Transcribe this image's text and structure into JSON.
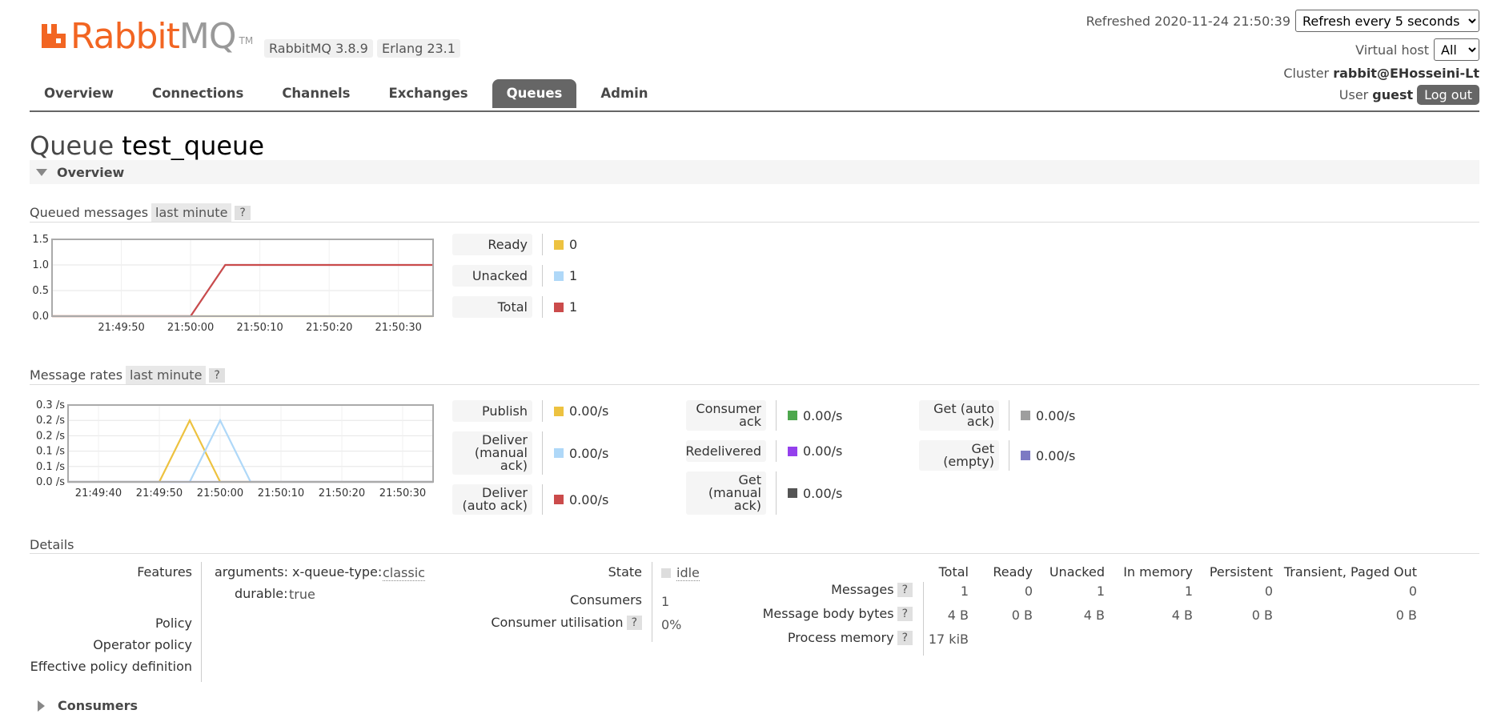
{
  "app": {
    "brand_main": "Rabbit",
    "brand_mq": "MQ",
    "brand_tm": "TM",
    "version": "RabbitMQ 3.8.9",
    "erlang": "Erlang 23.1"
  },
  "header": {
    "refreshed_label": "Refreshed 2020-11-24 21:50:39",
    "refresh_select": "Refresh every 5 seconds",
    "vhost_label": "Virtual host",
    "vhost_select": "All",
    "cluster_label": "Cluster",
    "cluster_value": "rabbit@EHosseini-Lt",
    "user_label": "User",
    "user_value": "guest",
    "logout": "Log out"
  },
  "nav": {
    "tabs": [
      "Overview",
      "Connections",
      "Channels",
      "Exchanges",
      "Queues",
      "Admin"
    ],
    "active": "Queues"
  },
  "page": {
    "title_prefix": "Queue",
    "queue_name": "test_queue"
  },
  "overview_section": "Overview",
  "queued": {
    "title": "Queued messages",
    "range": "last minute",
    "help": "?",
    "legend": [
      {
        "label": "Ready",
        "value": "0",
        "color": "#edc240"
      },
      {
        "label": "Unacked",
        "value": "1",
        "color": "#afd8f8"
      },
      {
        "label": "Total",
        "value": "1",
        "color": "#cb4b4b"
      }
    ]
  },
  "rates": {
    "title": "Message rates",
    "range": "last minute",
    "help": "?",
    "legend_col1": [
      {
        "label": "Publish",
        "value": "0.00/s",
        "color": "#edc240"
      },
      {
        "label": "Deliver (manual ack)",
        "value": "0.00/s",
        "color": "#afd8f8"
      },
      {
        "label": "Deliver (auto ack)",
        "value": "0.00/s",
        "color": "#cb4b4b"
      }
    ],
    "legend_col2": [
      {
        "label": "Consumer ack",
        "value": "0.00/s",
        "color": "#4da74d"
      },
      {
        "label": "Redelivered",
        "value": "0.00/s",
        "color": "#9440ed"
      },
      {
        "label": "Get (manual ack)",
        "value": "0.00/s",
        "color": "#545454"
      }
    ],
    "legend_col3": [
      {
        "label": "Get (auto ack)",
        "value": "0.00/s",
        "color": "#9e9e9e"
      },
      {
        "label": "Get (empty)",
        "value": "0.00/s",
        "color": "#7c79c3"
      }
    ]
  },
  "chart_data": [
    {
      "type": "line",
      "title": "",
      "x": [
        "21:49:40",
        "21:49:45",
        "21:49:50",
        "21:49:55",
        "21:50:00",
        "21:50:05",
        "21:50:10",
        "21:50:15",
        "21:50:20",
        "21:50:25",
        "21:50:30",
        "21:50:35"
      ],
      "xticks": [
        "21:49:50",
        "21:50:00",
        "21:50:10",
        "21:50:20",
        "21:50:30"
      ],
      "yticks": [
        "0.0",
        "0.5",
        "1.0",
        "1.5"
      ],
      "ylim": [
        0,
        1.5
      ],
      "grid": true,
      "series": [
        {
          "name": "Ready",
          "color": "#edc240",
          "values": [
            0,
            0,
            0,
            0,
            0,
            0,
            0,
            0,
            0,
            0,
            0,
            0
          ]
        },
        {
          "name": "Unacked",
          "color": "#afd8f8",
          "values": [
            0,
            0,
            0,
            0,
            0,
            1,
            1,
            1,
            1,
            1,
            1,
            1
          ]
        },
        {
          "name": "Total",
          "color": "#cb4b4b",
          "values": [
            0,
            0,
            0,
            0,
            0,
            1,
            1,
            1,
            1,
            1,
            1,
            1
          ]
        }
      ]
    },
    {
      "type": "line",
      "title": "",
      "x": [
        "21:49:35",
        "21:49:40",
        "21:49:45",
        "21:49:50",
        "21:49:55",
        "21:50:00",
        "21:50:05",
        "21:50:10",
        "21:50:15",
        "21:50:20",
        "21:50:25",
        "21:50:30",
        "21:50:35"
      ],
      "xticks": [
        "21:49:40",
        "21:49:50",
        "21:50:00",
        "21:50:10",
        "21:50:20",
        "21:50:30"
      ],
      "yticks": [
        "0.0 /s",
        "0.1 /s",
        "0.1 /s",
        "0.2 /s",
        "0.2 /s",
        "0.3 /s"
      ],
      "ylim": [
        0,
        0.25
      ],
      "grid": true,
      "series": [
        {
          "name": "Publish",
          "color": "#edc240",
          "values": [
            0,
            0,
            0,
            0,
            0.2,
            0,
            0,
            0,
            0,
            0,
            0,
            0,
            0
          ]
        },
        {
          "name": "Deliver (manual ack)",
          "color": "#afd8f8",
          "values": [
            0,
            0,
            0,
            0,
            0,
            0.2,
            0,
            0,
            0,
            0,
            0,
            0,
            0
          ]
        },
        {
          "name": "Get (empty)",
          "color": "#7c79c3",
          "values": [
            0,
            0,
            0,
            0,
            0,
            0,
            0,
            0,
            0,
            0,
            0,
            0,
            0
          ]
        }
      ]
    }
  ],
  "details": {
    "title": "Details",
    "features_label": "Features",
    "arguments_key": "arguments:",
    "xqt_key": "x-queue-type:",
    "xqt_val": "classic",
    "durable_key": "durable:",
    "durable_val": "true",
    "policy_label": "Policy",
    "operator_policy_label": "Operator policy",
    "effective_policy_label": "Effective policy definition",
    "state_label": "State",
    "state_val": "idle",
    "consumers_label": "Consumers",
    "consumers_val": "1",
    "utilisation_label": "Consumer utilisation",
    "utilisation_val": "0%",
    "help": "?",
    "table": {
      "headers": [
        "Total",
        "Ready",
        "Unacked",
        "In memory",
        "Persistent",
        "Transient, Paged Out"
      ],
      "rows": [
        {
          "label": "Messages",
          "cells": [
            "1",
            "0",
            "1",
            "1",
            "0",
            "0"
          ]
        },
        {
          "label": "Message body bytes",
          "cells": [
            "4 B",
            "0 B",
            "4 B",
            "4 B",
            "0 B",
            "0 B"
          ]
        },
        {
          "label": "Process memory",
          "cells": [
            "17 kiB"
          ]
        }
      ]
    }
  },
  "consumers_section": "Consumers"
}
